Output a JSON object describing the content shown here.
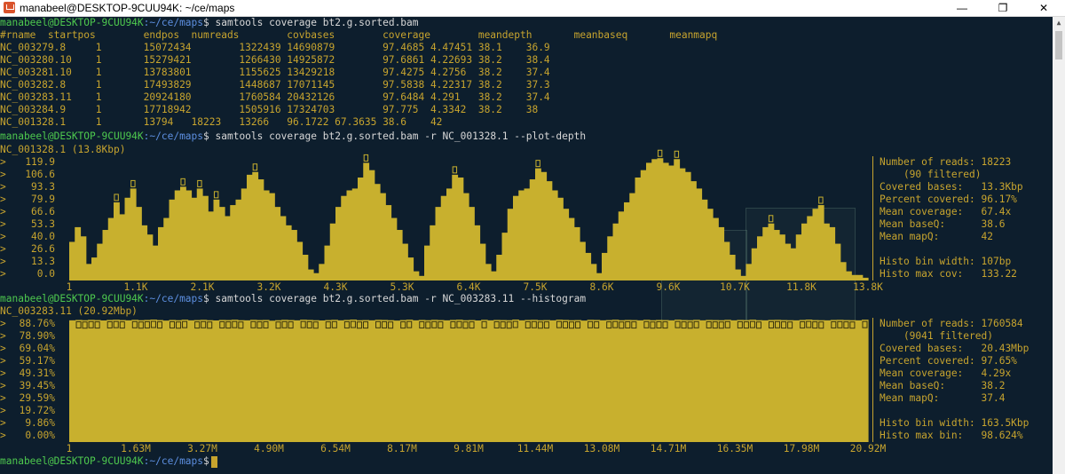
{
  "window": {
    "title": "manabeel@DESKTOP-9CUU94K: ~/ce/maps",
    "minimize_glyph": "—",
    "restore_glyph": "❐",
    "close_glyph": "✕"
  },
  "prompt": {
    "user_host": "manabeel@DESKTOP-9CUU94K",
    "path": ":~/ce/maps",
    "dollar": "$"
  },
  "commands": {
    "cmd1": " samtools coverage bt2.g.sorted.bam",
    "cmd2": " samtools coverage bt2.g.sorted.bam -r NC_001328.1 --plot-depth",
    "cmd3": " samtools coverage bt2.g.sorted.bam -r NC_003283.11 --histogram"
  },
  "table": {
    "header": "#rname  startpos        endpos  numreads        covbases        coverage        meandepth       meanbaseq       meanmapq",
    "rows": [
      "NC_003279.8     1       15072434        1322439 14690879        97.4685 4.47451 38.1    36.9",
      "NC_003280.10    1       15279421        1266430 14925872        97.6861 4.22693 38.2    38.4",
      "NC_003281.10    1       13783801        1155625 13429218        97.4275 4.2756  38.2    37.4",
      "NC_003282.8     1       17493829        1448687 17071145        97.5838 4.22317 38.2    37.3",
      "NC_003283.11    1       20924180        1760584 20432126        97.6484 4.291   38.2    37.4",
      "NC_003284.9     1       17718942        1505916 17324703        97.775  4.3342  38.2    38",
      "NC_001328.1     1       13794   18223   13266   96.1722 67.3635 38.6    42"
    ]
  },
  "depth_plot": {
    "title": "NC_001328.1 (13.8Kbp)",
    "y_ticks": [
      "119.9",
      "106.6",
      "93.3",
      "79.9",
      "66.6",
      "53.3",
      "40.0",
      "26.6",
      "13.3",
      "0.0"
    ],
    "x_ticks": [
      "1",
      "1.1K",
      "2.1K",
      "3.2K",
      "4.3K",
      "5.3K",
      "6.4K",
      "7.5K",
      "8.6K",
      "9.6K",
      "10.7K",
      "11.8K",
      "13.8K"
    ],
    "stats": [
      "Number of reads: 18223",
      "    (90 filtered)",
      "Covered bases:   13.3Kbp",
      "Percent covered: 96.17%",
      "Mean coverage:   67.4x",
      "Mean baseQ:      38.6",
      "Mean mapQ:       42",
      "",
      "Histo bin width: 107bp",
      "Histo max cov:   133.22"
    ]
  },
  "hist_plot": {
    "title": "NC_003283.11 (20.92Mbp)",
    "y_ticks": [
      "88.76%",
      "78.90%",
      "69.04%",
      "59.17%",
      "49.31%",
      "39.45%",
      "29.59%",
      "19.72%",
      "9.86%",
      "0.00%"
    ],
    "x_ticks": [
      "1",
      "1.63M",
      "3.27M",
      "4.90M",
      "6.54M",
      "8.17M",
      "9.81M",
      "11.44M",
      "13.08M",
      "14.71M",
      "16.35M",
      "17.98M",
      "20.92M"
    ],
    "stats": [
      "Number of reads: 1760584",
      "    (9041 filtered)",
      "Covered bases:   20.43Mbp",
      "Percent covered: 97.65%",
      "Mean coverage:   4.29x",
      "Mean baseQ:      38.2",
      "Mean mapQ:       37.4",
      "",
      "Histo bin width: 163.5Kbp",
      "Histo max bin:   98.624%"
    ]
  },
  "chart_data": [
    {
      "type": "bar",
      "title": "NC_001328.1 (13.8Kbp)",
      "xlabel": "",
      "ylabel": "",
      "ylim": [
        0,
        133.22
      ],
      "x_tick_labels": [
        "1",
        "1.1K",
        "2.1K",
        "3.2K",
        "4.3K",
        "5.3K",
        "6.4K",
        "7.5K",
        "8.6K",
        "9.6K",
        "10.7K",
        "11.8K",
        "13.8K"
      ],
      "bin_width_bp": 107,
      "values": [
        42,
        58,
        48,
        18,
        25,
        40,
        55,
        68,
        85,
        72,
        90,
        100,
        80,
        60,
        50,
        38,
        58,
        68,
        88,
        98,
        102,
        98,
        90,
        100,
        92,
        75,
        88,
        80,
        70,
        82,
        88,
        100,
        115,
        118,
        110,
        98,
        95,
        80,
        70,
        60,
        55,
        42,
        28,
        12,
        8,
        18,
        38,
        62,
        80,
        92,
        98,
        100,
        112,
        128,
        120,
        105,
        95,
        82,
        68,
        55,
        40,
        25,
        10,
        5,
        38,
        60,
        80,
        92,
        100,
        115,
        112,
        95,
        80,
        60,
        40,
        18,
        10,
        28,
        52,
        78,
        92,
        98,
        100,
        110,
        122,
        118,
        108,
        98,
        90,
        78,
        68,
        58,
        42,
        30,
        18,
        8,
        30,
        48,
        62,
        75,
        85,
        95,
        112,
        120,
        128,
        132,
        133,
        128,
        125,
        132,
        122,
        118,
        108,
        100,
        88,
        78,
        68,
        58,
        42,
        28,
        12,
        5,
        18,
        35,
        48,
        58,
        62,
        55,
        50,
        40,
        35,
        50,
        62,
        70,
        78,
        82,
        62,
        58,
        40,
        20,
        10,
        6,
        6,
        3
      ]
    },
    {
      "type": "bar",
      "title": "NC_003283.11 (20.92Mbp)",
      "xlabel": "",
      "ylabel": "",
      "ylim": [
        0,
        98.624
      ],
      "x_tick_labels": [
        "1",
        "1.63M",
        "3.27M",
        "4.90M",
        "6.54M",
        "8.17M",
        "9.81M",
        "11.44M",
        "13.08M",
        "14.71M",
        "16.35M",
        "17.98M",
        "20.92M"
      ],
      "bin_width_bp": 163500,
      "values": [
        98.0,
        98.3,
        98.1,
        98.4,
        98.2,
        97.9,
        98.3,
        98.5,
        98.2,
        98.0,
        98.4,
        98.1,
        98.3,
        98.6,
        98.2,
        97.8,
        98.3,
        98.1,
        98.5,
        98.0,
        98.2,
        98.4,
        98.1,
        97.9,
        98.3,
        98.2,
        98.5,
        98.1,
        98.0,
        98.4,
        98.2,
        98.3,
        97.7,
        98.1,
        98.4,
        98.2,
        98.0,
        98.5,
        98.3,
        98.1,
        97.9,
        98.2,
        98.4,
        98.0,
        98.3,
        98.6,
        98.1,
        98.2,
        98.0,
        98.4,
        98.3,
        98.1,
        97.8,
        98.2,
        98.5,
        98.0,
        98.3,
        98.1,
        98.4,
        98.2,
        98.0,
        98.3,
        98.5,
        98.1,
        98.2,
        97.9,
        98.4,
        98.0,
        98.3,
        98.2,
        98.1,
        98.6,
        98.0,
        98.3,
        98.4,
        98.1,
        98.2,
        98.0,
        98.5,
        98.3,
        98.1,
        98.2,
        97.8,
        98.4,
        98.3,
        98.0,
        98.2,
        98.5,
        98.1,
        98.3,
        98.2,
        98.0,
        98.4,
        98.1,
        98.3,
        98.2,
        98.0,
        98.5,
        98.2,
        98.1,
        98.4,
        98.0,
        98.3,
        98.2,
        98.1,
        98.4,
        98.0,
        98.3,
        98.2,
        98.5,
        98.1,
        98.0,
        98.3,
        98.4,
        98.2,
        98.1,
        98.0,
        98.3,
        98.6,
        98.2,
        98.1,
        98.0,
        98.3,
        98.4,
        98.2,
        98.1,
        98.0,
        98.5
      ]
    }
  ]
}
